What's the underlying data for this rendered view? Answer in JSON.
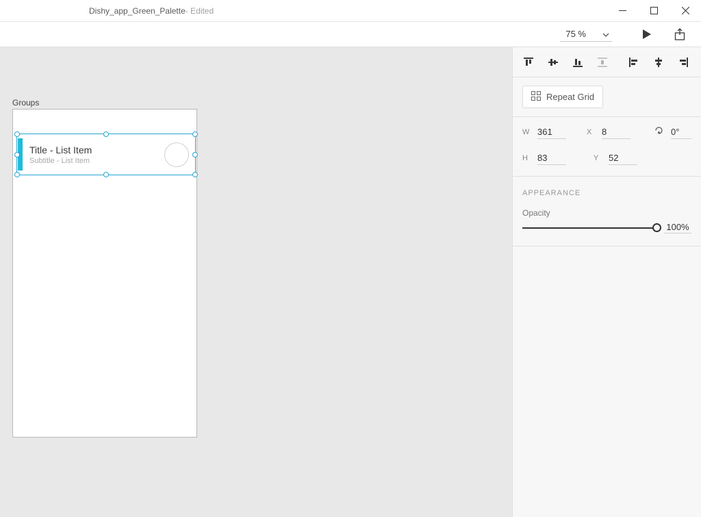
{
  "title": "Dishy_app_Green_Palette",
  "title_suffix": " - Edited",
  "toolbar": {
    "zoom": "75 %"
  },
  "canvas": {
    "artboard_label": "Groups",
    "list_item": {
      "title": "Title - List Item",
      "subtitle": "Subtitle - List Item"
    }
  },
  "panel": {
    "repeat_grid_label": "Repeat Grid",
    "transform": {
      "w_label": "W",
      "w": "361",
      "h_label": "H",
      "h": "83",
      "x_label": "X",
      "x": "8",
      "y_label": "Y",
      "y": "52",
      "rotation": "0°"
    },
    "appearance": {
      "section_label": "APPEARANCE",
      "opacity_label": "Opacity",
      "opacity_value": "100%"
    }
  }
}
